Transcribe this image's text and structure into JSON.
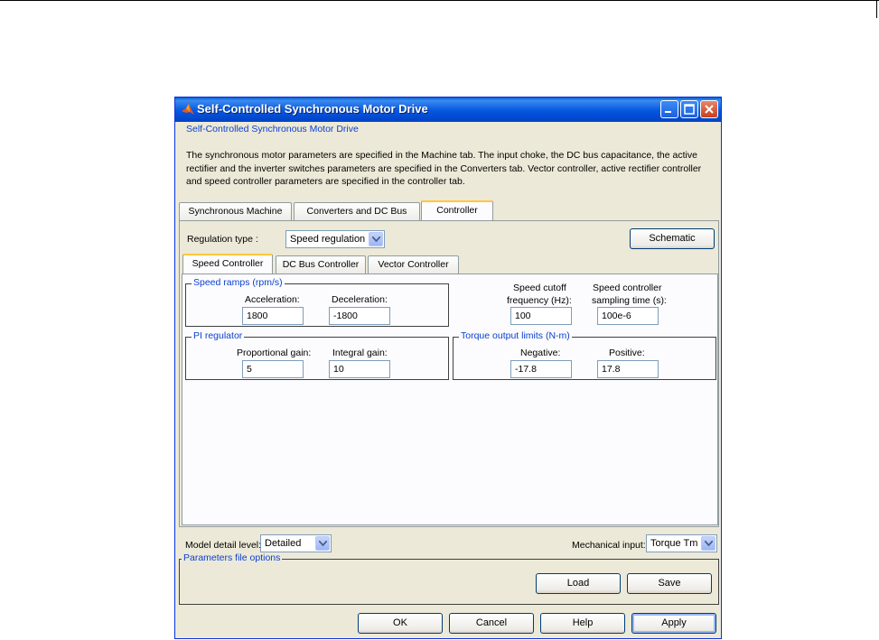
{
  "window": {
    "title": "Self-Controlled Synchronous Motor Drive"
  },
  "header": {
    "block_name": "Self-Controlled Synchronous Motor Drive",
    "description": "The synchronous motor parameters are specified in the Machine tab. The input choke, the DC bus capacitance, the active rectifier and the inverter switches parameters are specified in the Converters tab. Vector controller, active rectifier controller and speed controller parameters are specified in the controller tab."
  },
  "main_tabs": [
    {
      "label": "Synchronous Machine",
      "active": false
    },
    {
      "label": "Converters and DC Bus",
      "active": false
    },
    {
      "label": "Controller",
      "active": true
    }
  ],
  "controller": {
    "regulation_type_label": "Regulation type :",
    "regulation_type_value": "Speed regulation",
    "schematic_label": "Schematic",
    "sub_tabs": [
      {
        "label": "Speed Controller",
        "active": true
      },
      {
        "label": "DC Bus Controller",
        "active": false
      },
      {
        "label": "Vector Controller",
        "active": false
      }
    ],
    "speed_ramps": {
      "title": "Speed ramps (rpm/s)",
      "acceleration_label": "Acceleration:",
      "acceleration_value": "1800",
      "deceleration_label": "Deceleration:",
      "deceleration_value": "-1800"
    },
    "cutoff": {
      "label_line1": "Speed cutoff",
      "label_line2": "frequency (Hz):",
      "value": "100"
    },
    "sampling": {
      "label_line1": "Speed controller",
      "label_line2": "sampling time (s):",
      "value": "100e-6"
    },
    "pi_regulator": {
      "title": "PI regulator",
      "proportional_label": "Proportional gain:",
      "proportional_value": "5",
      "integral_label": "Integral gain:",
      "integral_value": "10"
    },
    "torque_limits": {
      "title": "Torque output limits (N-m)",
      "negative_label": "Negative:",
      "negative_value": "-17.8",
      "positive_label": "Positive:",
      "positive_value": "17.8"
    }
  },
  "bottom": {
    "model_detail_label": "Model detail level:",
    "model_detail_value": "Detailed",
    "mech_input_label": "Mechanical input:",
    "mech_input_value": "Torque Tm",
    "params_file_title": "Parameters file options",
    "load_label": "Load",
    "save_label": "Save"
  },
  "dialog_buttons": {
    "ok": "OK",
    "cancel": "Cancel",
    "help": "Help",
    "apply": "Apply"
  },
  "colors": {
    "titlebar": "#0656e0",
    "group_title": "#0a3fcf",
    "active_tab_highlight": "#ffc83c"
  }
}
